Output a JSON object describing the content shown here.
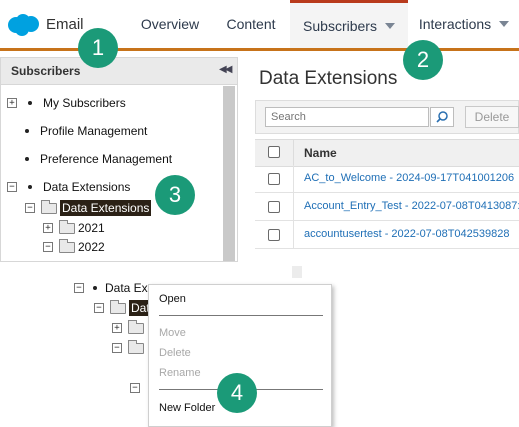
{
  "app": {
    "title": "Email",
    "logo_icon": "salesforce-cloud-icon",
    "brand_color": "#00a1e0",
    "accent_color": "#c7731a"
  },
  "tabs": [
    {
      "label": "Overview"
    },
    {
      "label": "Content"
    },
    {
      "label": "Subscribers",
      "active": true
    },
    {
      "label": "Interactions"
    }
  ],
  "left_panel": {
    "title": "Subscribers",
    "collapse_icon": "double-chevron-left-icon",
    "items": [
      {
        "label": "My Subscribers",
        "toggle": "+"
      },
      {
        "label": "Profile Management"
      },
      {
        "label": "Preference Management"
      },
      {
        "label": "Data Extensions",
        "toggle": "−"
      }
    ],
    "folders": [
      {
        "label": "Data Extensions",
        "toggle": "−",
        "selected": true
      },
      {
        "label": "2021",
        "toggle": "+"
      },
      {
        "label": "2022",
        "toggle": "−"
      }
    ]
  },
  "main": {
    "title": "Data Extensions",
    "search_placeholder": "Search",
    "delete_label": "Delete",
    "column_name": "Name",
    "rows": [
      "AC_to_Welcome - 2024-09-17T041001206",
      "Account_Entry_Test - 2022-07-08T0413087:",
      "accountusertest - 2022-07-08T042539828"
    ]
  },
  "context_tree": {
    "root_label": "Data Ex",
    "selected_folder_label": "Dat"
  },
  "context_menu": {
    "open": "Open",
    "move": "Move",
    "delete": "Delete",
    "rename": "Rename",
    "new_folder": "New Folder"
  },
  "callouts": [
    "1",
    "2",
    "3",
    "4"
  ]
}
